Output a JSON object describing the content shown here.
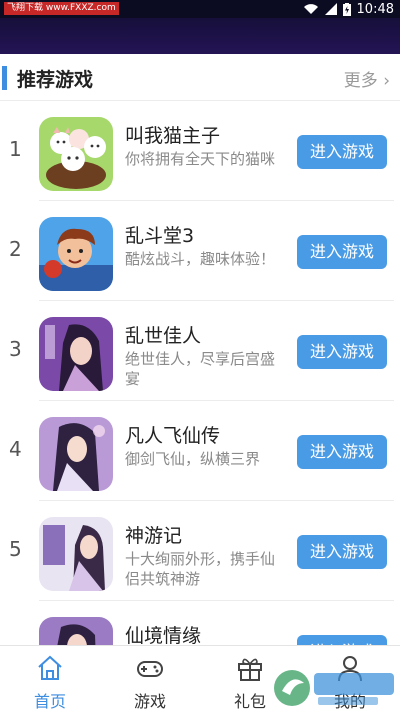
{
  "status_bar": {
    "carrier": "飞翔下载 www.FXXZ.com",
    "time": "10:48"
  },
  "section": {
    "title": "推荐游戏",
    "more": "更多",
    "more_chevron": "›"
  },
  "games": [
    {
      "rank": "1",
      "name": "叫我猫主子",
      "desc": "你将拥有全天下的猫咪",
      "button": "进入游戏"
    },
    {
      "rank": "2",
      "name": "乱斗堂3",
      "desc": "酷炫战斗，趣味体验！",
      "button": "进入游戏"
    },
    {
      "rank": "3",
      "name": "乱世佳人",
      "desc": "绝世佳人，尽享后宫盛宴",
      "button": "进入游戏"
    },
    {
      "rank": "4",
      "name": "凡人飞仙传",
      "desc": "御剑飞仙，纵横三界",
      "button": "进入游戏"
    },
    {
      "rank": "5",
      "name": "神游记",
      "desc": "十大绚丽外形，携手仙侣共筑神游",
      "button": "进入游戏"
    },
    {
      "rank": "",
      "name": "仙境情缘",
      "desc": "",
      "button": "进入游戏"
    }
  ],
  "tabs": [
    {
      "label": "首页",
      "icon": "home-icon"
    },
    {
      "label": "游戏",
      "icon": "gamepad-icon"
    },
    {
      "label": "礼包",
      "icon": "gift-icon"
    },
    {
      "label": "我的",
      "icon": "user-icon"
    }
  ],
  "colors": {
    "accent": "#3d8de0",
    "button": "#4a9be6",
    "header": "#1c1247"
  }
}
